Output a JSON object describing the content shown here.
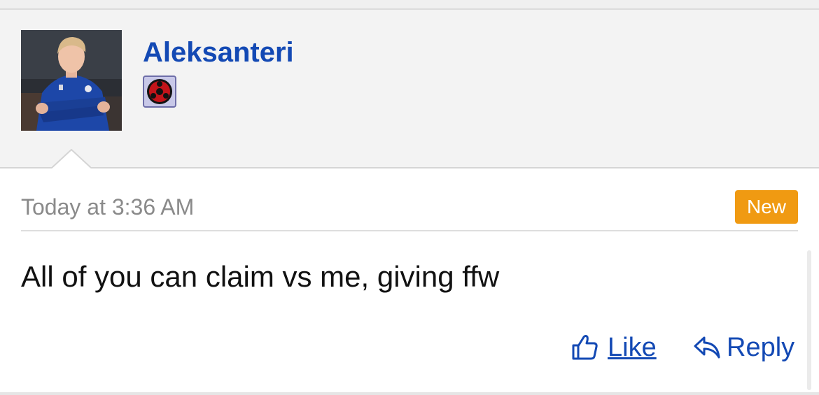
{
  "post": {
    "username": "Aleksanteri",
    "timestamp": "Today at 3:36 AM",
    "badge": "New",
    "message": "All of you can claim vs me, giving ffw"
  },
  "actions": {
    "like_label": "Like",
    "like_icon": "thumbs-up-icon",
    "reply_label": "Reply",
    "reply_icon": "reply-arrow-icon"
  },
  "user": {
    "avatar": "avatar",
    "role_badge_icon": "sharingan-badge-icon"
  },
  "colors": {
    "link": "#1349b4",
    "badge_bg": "#f09a12",
    "header_bg": "#f3f3f3",
    "timestamp": "#8a8a8a"
  }
}
